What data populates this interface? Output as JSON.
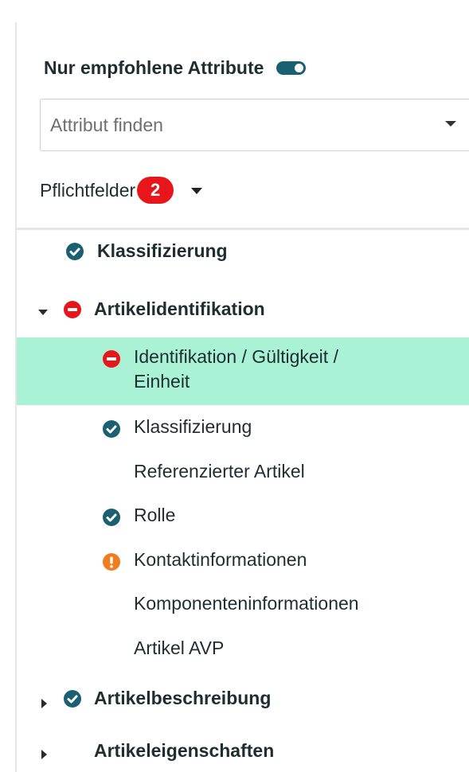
{
  "panel": {
    "title": "Nur empfohlene Attribute",
    "toggle_on": true
  },
  "search": {
    "placeholder": "Attribut finden"
  },
  "required": {
    "label": "Pflichtfelder",
    "count": "2"
  },
  "tree": [
    {
      "label": "Klassifizierung",
      "status": "check-icon",
      "level": 1
    },
    {
      "label": "Artikelidentifikation",
      "status": "error-icon",
      "level": 1,
      "expanded": true
    },
    {
      "label": "Identifikation / Gültigkeit / Einheit",
      "line1": "Identifikation / Gültigkeit /",
      "line2": "Einheit",
      "status": "error-icon",
      "level": 2,
      "selected": true
    },
    {
      "label": "Klassifizierung",
      "status": "check-icon",
      "level": 2
    },
    {
      "label": "Referenzierter Artikel",
      "status": "",
      "level": 2
    },
    {
      "label": "Rolle",
      "status": "check-icon",
      "level": 2
    },
    {
      "label": "Kontaktinformationen",
      "status": "warning-icon",
      "level": 2
    },
    {
      "label": "Komponenteninformationen",
      "status": "",
      "level": 2
    },
    {
      "label": "Artikel AVP",
      "status": "",
      "level": 2
    },
    {
      "label": "Artikelbeschreibung",
      "status": "check-icon",
      "level": 1,
      "expanded": false
    },
    {
      "label": "Artikeleigenschaften",
      "status": "",
      "level": 1,
      "expanded": false
    }
  ],
  "colors": {
    "check": "#1b5f73",
    "error": "#e8151b",
    "warning": "#f07d1e",
    "selected_bg": "#aaf2d6"
  }
}
